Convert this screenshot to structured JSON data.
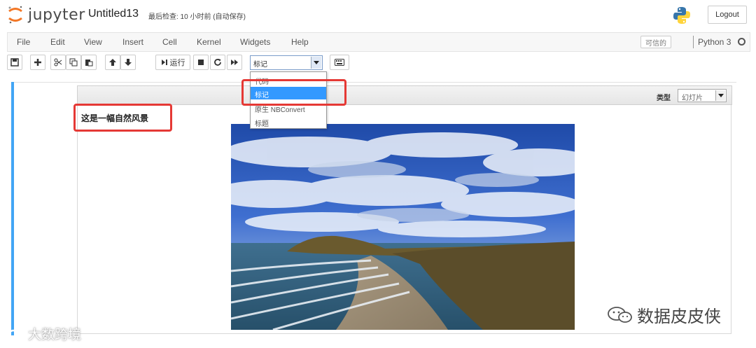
{
  "header": {
    "logo_text": "jupyter",
    "notebook_title": "Untitled13",
    "checkpoint_text": "最后检查: 10 小时前 (自动保存)",
    "logout_label": "Logout"
  },
  "menubar": {
    "items": [
      "File",
      "Edit",
      "View",
      "Insert",
      "Cell",
      "Kernel",
      "Widgets",
      "Help"
    ],
    "trusted_label": "可信的",
    "kernel_name": "Python 3"
  },
  "toolbar": {
    "run_label": "运行",
    "celltype_selected": "标记"
  },
  "celltype_dropdown": {
    "options": [
      "代码",
      "标记",
      "原生 NBConvert",
      "标题"
    ],
    "selected_index": 1
  },
  "cell": {
    "slide_type_label": "类型",
    "slide_type_value": "幻灯片",
    "markdown_text": "这是一幅自然风景"
  },
  "watermarks": {
    "left": "大数跨境",
    "right": "数据皮皮侠"
  },
  "colors": {
    "accent_blue": "#42a5f5",
    "selection_blue": "#3399ff",
    "highlight_red": "#e53935",
    "jupyter_orange": "#f37726"
  }
}
